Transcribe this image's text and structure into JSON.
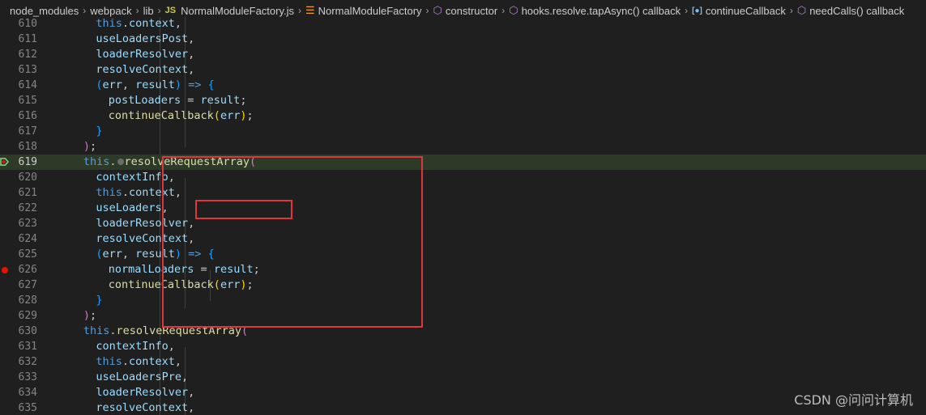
{
  "breadcrumb": {
    "items": [
      {
        "label": "node_modules",
        "icon": ""
      },
      {
        "label": "webpack",
        "icon": ""
      },
      {
        "label": "lib",
        "icon": ""
      },
      {
        "label": "NormalModuleFactory.js",
        "icon": "js-file-icon",
        "icon_text": "JS"
      },
      {
        "label": "NormalModuleFactory",
        "icon": "class-icon"
      },
      {
        "label": "constructor",
        "icon": "method-icon"
      },
      {
        "label": "hooks.resolve.tapAsync() callback",
        "icon": "method-icon"
      },
      {
        "label": "continueCallback",
        "icon": "variable-icon"
      },
      {
        "label": "needCalls() callback",
        "icon": "method-icon"
      }
    ]
  },
  "editor": {
    "current_line": 619,
    "breakpoint_lines": [
      626
    ],
    "lines": [
      {
        "n": "610",
        "indent": 6,
        "tokens": [
          [
            "k",
            "this"
          ],
          [
            "p",
            "."
          ],
          [
            "v",
            "context"
          ],
          [
            "p",
            ","
          ]
        ]
      },
      {
        "n": "611",
        "indent": 6,
        "tokens": [
          [
            "v",
            "useLoadersPost"
          ],
          [
            "p",
            ","
          ]
        ]
      },
      {
        "n": "612",
        "indent": 6,
        "tokens": [
          [
            "v",
            "loaderResolver"
          ],
          [
            "p",
            ","
          ]
        ]
      },
      {
        "n": "613",
        "indent": 6,
        "tokens": [
          [
            "v",
            "resolveContext"
          ],
          [
            "p",
            ","
          ]
        ]
      },
      {
        "n": "614",
        "indent": 6,
        "tokens": [
          [
            "b3",
            "("
          ],
          [
            "v",
            "err"
          ],
          [
            "p",
            ", "
          ],
          [
            "v",
            "result"
          ],
          [
            "b3",
            ")"
          ],
          [
            "p",
            " "
          ],
          [
            "k",
            "=>"
          ],
          [
            "p",
            " "
          ],
          [
            "b3",
            "{"
          ]
        ]
      },
      {
        "n": "615",
        "indent": 8,
        "tokens": [
          [
            "v",
            "postLoaders"
          ],
          [
            "p",
            " = "
          ],
          [
            "v",
            "result"
          ],
          [
            "p",
            ";"
          ]
        ]
      },
      {
        "n": "616",
        "indent": 8,
        "tokens": [
          [
            "f",
            "continueCallback"
          ],
          [
            "b1",
            "("
          ],
          [
            "v",
            "err"
          ],
          [
            "b1",
            ")"
          ],
          [
            "p",
            ";"
          ]
        ]
      },
      {
        "n": "617",
        "indent": 6,
        "tokens": [
          [
            "b3",
            "}"
          ]
        ]
      },
      {
        "n": "618",
        "indent": 4,
        "tokens": [
          [
            "b2",
            ")"
          ],
          [
            "p",
            ";"
          ]
        ]
      },
      {
        "n": "619",
        "indent": 4,
        "tokens": [
          [
            "k",
            "this"
          ],
          [
            "p",
            "."
          ],
          [
            "dot",
            ""
          ],
          [
            "f",
            "resolveRequestArray"
          ],
          [
            "b2",
            "("
          ]
        ]
      },
      {
        "n": "620",
        "indent": 6,
        "tokens": [
          [
            "v",
            "contextInfo"
          ],
          [
            "p",
            ","
          ]
        ]
      },
      {
        "n": "621",
        "indent": 6,
        "tokens": [
          [
            "k",
            "this"
          ],
          [
            "p",
            "."
          ],
          [
            "v",
            "context"
          ],
          [
            "p",
            ","
          ]
        ]
      },
      {
        "n": "622",
        "indent": 6,
        "tokens": [
          [
            "v",
            "useLoaders"
          ],
          [
            "p",
            ","
          ]
        ]
      },
      {
        "n": "623",
        "indent": 6,
        "tokens": [
          [
            "v",
            "loaderResolver"
          ],
          [
            "p",
            ","
          ]
        ]
      },
      {
        "n": "624",
        "indent": 6,
        "tokens": [
          [
            "v",
            "resolveContext"
          ],
          [
            "p",
            ","
          ]
        ]
      },
      {
        "n": "625",
        "indent": 6,
        "tokens": [
          [
            "b3",
            "("
          ],
          [
            "v",
            "err"
          ],
          [
            "p",
            ", "
          ],
          [
            "v",
            "result"
          ],
          [
            "b3",
            ")"
          ],
          [
            "p",
            " "
          ],
          [
            "k",
            "=>"
          ],
          [
            "p",
            " "
          ],
          [
            "b3",
            "{"
          ]
        ]
      },
      {
        "n": "626",
        "indent": 8,
        "tokens": [
          [
            "v",
            "normalLoaders"
          ],
          [
            "p",
            " = "
          ],
          [
            "v",
            "result"
          ],
          [
            "p",
            ";"
          ]
        ]
      },
      {
        "n": "627",
        "indent": 8,
        "tokens": [
          [
            "f",
            "continueCallback"
          ],
          [
            "b1",
            "("
          ],
          [
            "v",
            "err"
          ],
          [
            "b1",
            ")"
          ],
          [
            "p",
            ";"
          ]
        ]
      },
      {
        "n": "628",
        "indent": 6,
        "tokens": [
          [
            "b3",
            "}"
          ]
        ]
      },
      {
        "n": "629",
        "indent": 4,
        "tokens": [
          [
            "b2",
            ")"
          ],
          [
            "p",
            ";"
          ]
        ]
      },
      {
        "n": "630",
        "indent": 4,
        "tokens": [
          [
            "k",
            "this"
          ],
          [
            "p",
            "."
          ],
          [
            "f",
            "resolveRequestArray"
          ],
          [
            "b2",
            "("
          ]
        ]
      },
      {
        "n": "631",
        "indent": 6,
        "tokens": [
          [
            "v",
            "contextInfo"
          ],
          [
            "p",
            ","
          ]
        ]
      },
      {
        "n": "632",
        "indent": 6,
        "tokens": [
          [
            "k",
            "this"
          ],
          [
            "p",
            "."
          ],
          [
            "v",
            "context"
          ],
          [
            "p",
            ","
          ]
        ]
      },
      {
        "n": "633",
        "indent": 6,
        "tokens": [
          [
            "v",
            "useLoadersPre"
          ],
          [
            "p",
            ","
          ]
        ]
      },
      {
        "n": "634",
        "indent": 6,
        "tokens": [
          [
            "v",
            "loaderResolver"
          ],
          [
            "p",
            ","
          ]
        ]
      },
      {
        "n": "635",
        "indent": 6,
        "tokens": [
          [
            "v",
            "resolveContext"
          ],
          [
            "p",
            ","
          ]
        ]
      }
    ]
  },
  "watermark": "CSDN @问问计算机",
  "colors": {
    "background": "#1f1f1f",
    "current_line": "#2d3a28",
    "breakpoint": "#e51400",
    "annotation_box": "#e0353b",
    "keyword": "#569cd6",
    "variable": "#9cdcfe",
    "function": "#dcdcaa"
  }
}
